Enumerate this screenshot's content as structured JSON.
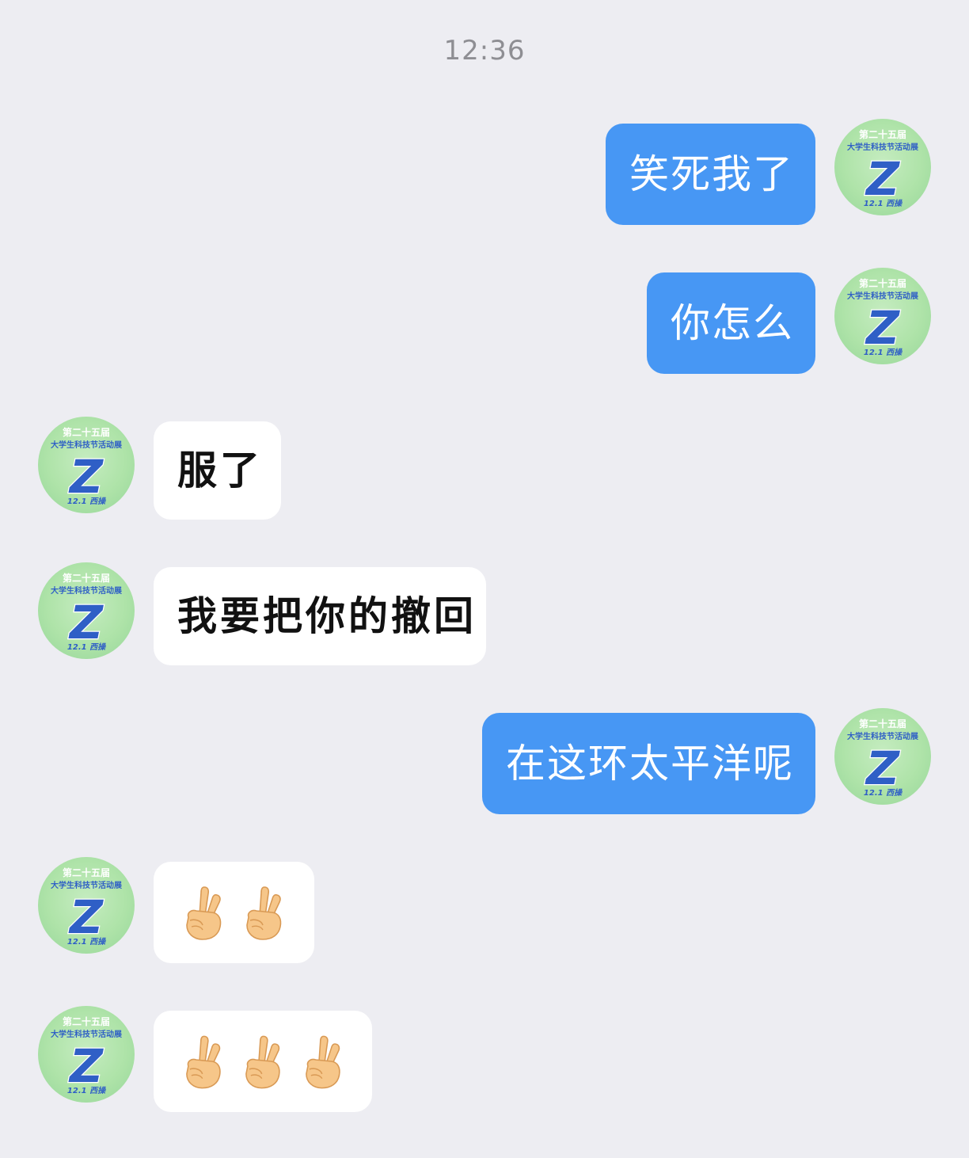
{
  "timestamp": "12:36",
  "avatar": {
    "line1": "第二十五届",
    "line2": "大学生科技节活动展",
    "letter": "Z",
    "footer": "12.1  西操",
    "colors": {
      "bg": "#aee3a8",
      "letter": "#2f5fc6",
      "text": "#ffffff"
    }
  },
  "colors": {
    "outgoing": "#4797f4",
    "incoming": "#ffffff",
    "background": "#ededf2"
  },
  "messages": [
    {
      "direction": "outgoing",
      "text": "笑死我了"
    },
    {
      "direction": "outgoing",
      "text": "你怎么"
    },
    {
      "direction": "incoming",
      "text": "服了"
    },
    {
      "direction": "incoming",
      "text": "我要把你的撤回"
    },
    {
      "direction": "outgoing",
      "text": "在这环太平洋呢"
    },
    {
      "direction": "incoming",
      "emoji": "victory-hand",
      "count": 2
    },
    {
      "direction": "incoming",
      "emoji": "victory-hand",
      "count": 3
    }
  ]
}
